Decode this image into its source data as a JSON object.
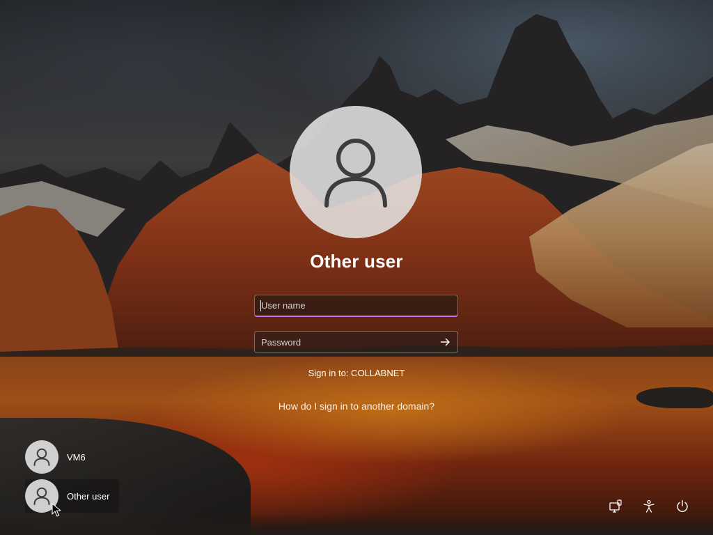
{
  "signin": {
    "title": "Other user",
    "username_placeholder": "User name",
    "password_placeholder": "Password",
    "sign_in_to": "Sign in to: COLLABNET",
    "domain_help_link": "How do I sign in to another domain?"
  },
  "users": [
    {
      "label": "VM6",
      "icon": "person-icon"
    },
    {
      "label": "Other user",
      "icon": "person-icon",
      "selected": true
    }
  ],
  "system_buttons": [
    {
      "icon": "network-icon"
    },
    {
      "icon": "accessibility-icon"
    },
    {
      "icon": "power-icon"
    }
  ],
  "colors": {
    "focus_underline": "#c974e6",
    "avatar_bg": "#e8e8e8"
  }
}
